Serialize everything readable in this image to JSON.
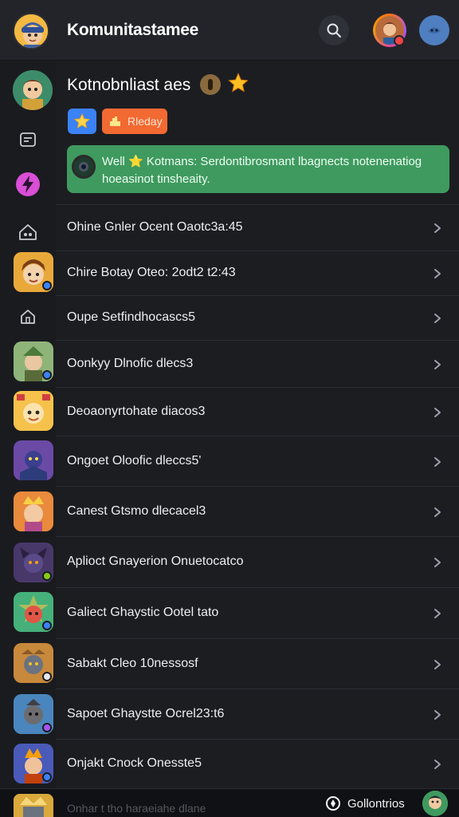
{
  "topbar": {
    "app_title": "Komunitastamee",
    "icons": {
      "search": "search-icon",
      "user": "user-avatar",
      "bot": "bot-icon"
    }
  },
  "header": {
    "title": "Kotnobnliast aes",
    "chip_ready": "Rleday"
  },
  "notice": {
    "text": "Well ⭐ Kotmans: Serdontibrosmant lbagnects notenenatiog hoeasinot tinsheaity."
  },
  "list": {
    "rows": [
      {
        "label": "Ohine Gnler Ocent Oaotc3a:45"
      },
      {
        "label": "Chire Botay Oteo: 2odt2 t2:43"
      },
      {
        "label": "Oupe Setfindhocascs5"
      },
      {
        "label": "Oonkyy Dlnofic dlecs3"
      },
      {
        "label": "Deoaonyrtohate diacos3"
      },
      {
        "label": "Ongoet Oloofic dleccs5'"
      },
      {
        "label": "Canest Gtsmo dlecacel3"
      },
      {
        "label": "Aplioct Gnayerion Onuetocatco"
      },
      {
        "label": "Galiect Ghaystic Ootel tato"
      },
      {
        "label": "Sabakt Cleo 10nessosf"
      },
      {
        "label": "Sapoet Ghaystte Ocrel23:t6"
      },
      {
        "label": "Onjakt Cnock Onesste5"
      }
    ]
  },
  "bottombar": {
    "faded_text": "Onhar t tho haraeiahe dlane",
    "link_label": "Gollontrios"
  },
  "colors": {
    "background": "#1c1d21",
    "notice": "#3f9a5f",
    "chip_ready": "#f26a32",
    "chip_star": "#3b82f6"
  }
}
